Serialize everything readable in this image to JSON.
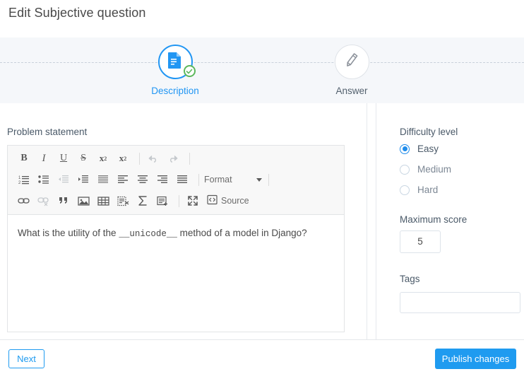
{
  "page": {
    "title": "Edit Subjective question"
  },
  "stepper": {
    "steps": [
      {
        "label": "Description",
        "state": "active-complete",
        "icon": "document-icon",
        "badge": "check-badge"
      },
      {
        "label": "Answer",
        "state": "inactive",
        "icon": "pencil-icon"
      }
    ]
  },
  "editor_panel": {
    "label": "Problem statement",
    "content_prefix": "What is the utility of the ",
    "content_code": "__unicode__",
    "content_suffix": " method of a model in Django?",
    "toolbar": {
      "row1": [
        {
          "name": "bold-icon",
          "label": "B",
          "disabled": false
        },
        {
          "name": "italic-icon",
          "label": "I",
          "disabled": false
        },
        {
          "name": "underline-icon",
          "label": "U",
          "disabled": false
        },
        {
          "name": "strikethrough-icon",
          "label": "S",
          "disabled": false
        },
        {
          "name": "subscript-icon",
          "label": "x",
          "sub": "2",
          "disabled": false
        },
        {
          "name": "superscript-icon",
          "label": "x",
          "sup": "2",
          "disabled": false
        },
        {
          "name": "undo-icon",
          "label": "",
          "disabled": true
        },
        {
          "name": "redo-icon",
          "label": "",
          "disabled": true
        }
      ],
      "row2": [
        {
          "name": "numbered-list-icon",
          "disabled": false
        },
        {
          "name": "bulleted-list-icon",
          "disabled": false
        },
        {
          "name": "decrease-indent-icon",
          "disabled": true
        },
        {
          "name": "increase-indent-icon",
          "disabled": false
        },
        {
          "name": "align-block-icon",
          "disabled": false
        },
        {
          "name": "align-left-icon",
          "disabled": false
        },
        {
          "name": "align-center-icon",
          "disabled": false
        },
        {
          "name": "align-right-icon",
          "disabled": false
        },
        {
          "name": "align-justify-icon",
          "disabled": false
        }
      ],
      "format_label": "Format",
      "row3": [
        {
          "name": "link-icon",
          "disabled": false
        },
        {
          "name": "unlink-icon",
          "disabled": true
        },
        {
          "name": "blockquote-icon",
          "disabled": false
        },
        {
          "name": "image-icon",
          "disabled": false
        },
        {
          "name": "table-icon",
          "disabled": false
        },
        {
          "name": "code-block-icon",
          "disabled": false
        },
        {
          "name": "math-sigma-icon",
          "disabled": false
        },
        {
          "name": "insert-template-icon",
          "disabled": false
        },
        {
          "name": "maximize-icon",
          "disabled": false
        }
      ],
      "source_label": "Source"
    }
  },
  "settings_panel": {
    "difficulty_label": "Difficulty level",
    "difficulty_options": [
      {
        "label": "Easy",
        "selected": true
      },
      {
        "label": "Medium",
        "selected": false
      },
      {
        "label": "Hard",
        "selected": false
      }
    ],
    "max_score_label": "Maximum score",
    "max_score_value": "5",
    "tags_label": "Tags",
    "tags_value": "",
    "tags_placeholder": ""
  },
  "footer": {
    "next_label": "Next",
    "publish_label": "Publish changes"
  },
  "colors": {
    "accent_blue": "#1f9bf0",
    "step_blue": "#2196f3",
    "check_green": "#5cb85c",
    "band_gray": "#f5f7fa",
    "toolbar_gray": "#f8f8f8"
  }
}
